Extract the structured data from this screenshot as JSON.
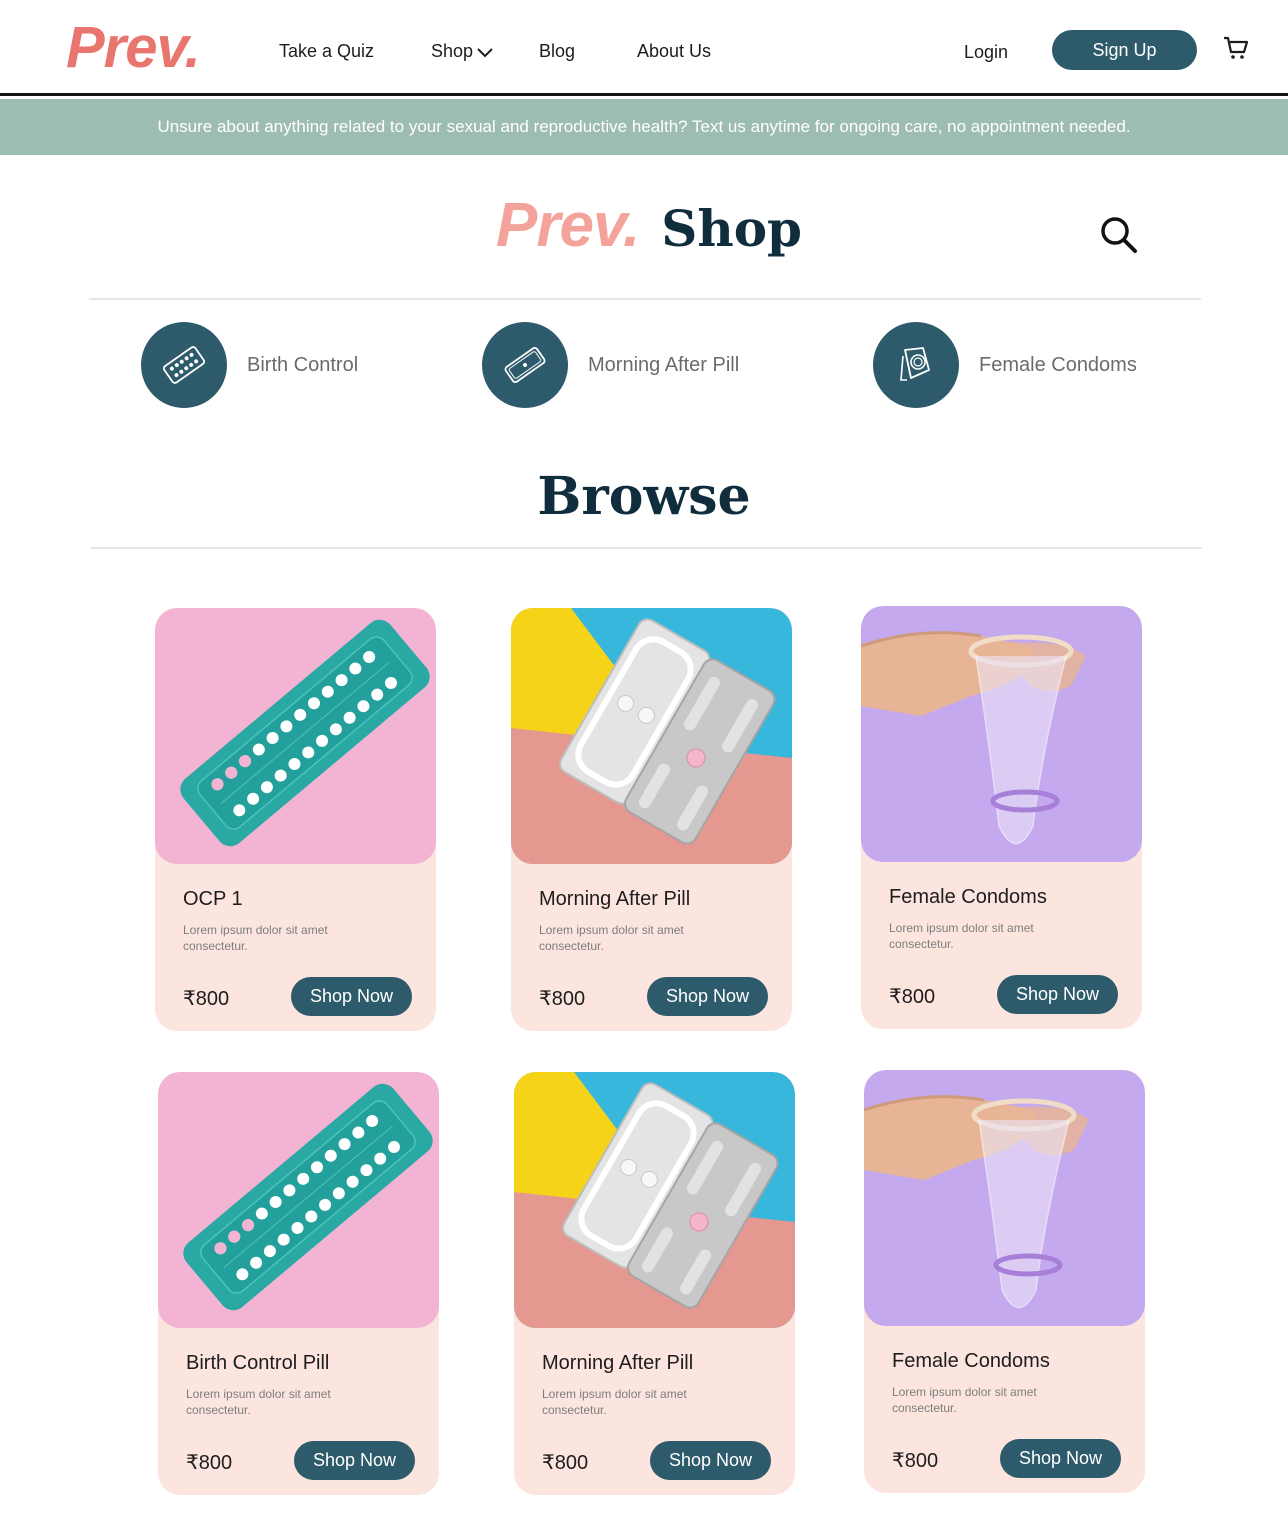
{
  "header": {
    "logo": "Prev.",
    "nav": [
      "Take a Quiz",
      "Shop",
      "Blog",
      "About Us"
    ],
    "login": "Login",
    "signup": "Sign Up"
  },
  "banner": {
    "text": "Unsure about anything related to your sexual and reproductive health? Text us anytime for ongoing care, no appointment needed."
  },
  "shop_header": {
    "logo": "Prev.",
    "title": "Shop"
  },
  "categories": [
    {
      "label": "Birth Control",
      "icon": "pill-pack-icon"
    },
    {
      "label": "Morning After Pill",
      "icon": "single-pill-pack-icon"
    },
    {
      "label": "Female Condoms",
      "icon": "condom-icon"
    }
  ],
  "browse_title": "Browse",
  "products": [
    {
      "title": "OCP 1",
      "desc": "Lorem ipsum dolor sit amet consectetur.",
      "price": "₹800",
      "button": "Shop Now",
      "image": "birth-control-pack"
    },
    {
      "title": "Morning After Pill",
      "desc": "Lorem ipsum dolor sit amet consectetur.",
      "price": "₹800",
      "button": "Shop Now",
      "image": "morning-after-pill-pack"
    },
    {
      "title": "Female Condoms",
      "desc": "Lorem ipsum dolor sit amet consectetur.",
      "price": "₹800",
      "button": "Shop Now",
      "image": "female-condom"
    },
    {
      "title": "Birth Control Pill",
      "desc": "Lorem ipsum dolor sit amet consectetur.",
      "price": "₹800",
      "button": "Shop Now",
      "image": "birth-control-pack"
    },
    {
      "title": "Morning After Pill",
      "desc": "Lorem ipsum dolor sit amet consectetur.",
      "price": "₹800",
      "button": "Shop Now",
      "image": "morning-after-pill-pack"
    },
    {
      "title": "Female Condoms",
      "desc": "Lorem ipsum dolor sit amet consectetur.",
      "price": "₹800",
      "button": "Shop Now",
      "image": "female-condom"
    }
  ],
  "colors": {
    "accent": "#2e5b6b",
    "logo": "#e8766e",
    "banner": "#9dbcb3",
    "card": "#fde5df",
    "heading": "#0f2d3c"
  }
}
